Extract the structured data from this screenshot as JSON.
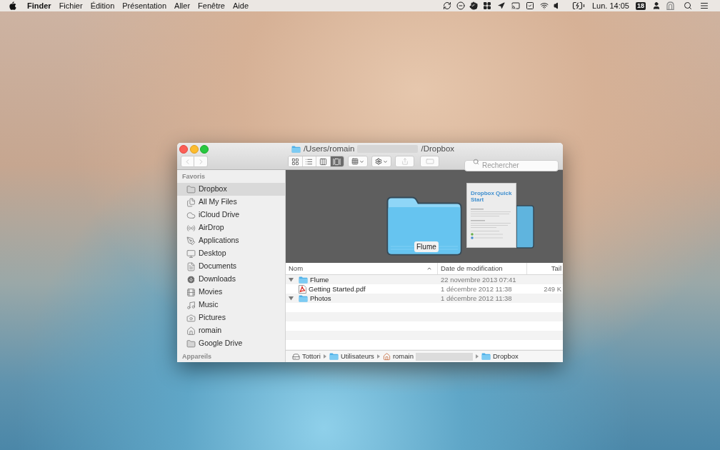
{
  "menubar": {
    "menus": [
      {
        "label": "Finder",
        "kind": "app"
      },
      {
        "label": "Fichier",
        "kind": "menu"
      },
      {
        "label": "Édition",
        "kind": "menu"
      },
      {
        "label": "Présentation",
        "kind": "menu"
      },
      {
        "label": "Aller",
        "kind": "menu"
      },
      {
        "label": "Fenêtre",
        "kind": "menu"
      },
      {
        "label": "Aide",
        "kind": "menu"
      }
    ],
    "clock": "Lun. 14:05",
    "calendar_date": "18"
  },
  "window": {
    "title_start": "/Users/romain",
    "title_redacted": true,
    "title_end": "/Dropbox",
    "toolbar": {
      "back": {
        "disabled": true
      },
      "forward": {
        "disabled": true
      },
      "view_modes": [
        {
          "kind": "icons",
          "selected": false
        },
        {
          "kind": "list",
          "selected": false
        },
        {
          "kind": "columns",
          "selected": false
        },
        {
          "kind": "coverflow",
          "selected": true
        }
      ],
      "share": {
        "disabled": true
      },
      "tags": {
        "disabled": true
      },
      "search": {
        "placeholder": "Rechercher"
      }
    },
    "sidebar": {
      "sections": [
        {
          "heading": "Favoris",
          "items": [
            {
              "label": "Dropbox",
              "kind": "folder",
              "selected": true
            },
            {
              "label": "All My Files",
              "kind": "files",
              "selected": false
            },
            {
              "label": "iCloud Drive",
              "kind": "cloud",
              "selected": false
            },
            {
              "label": "AirDrop",
              "kind": "airdrop",
              "selected": false
            },
            {
              "label": "Applications",
              "kind": "apps",
              "selected": false
            },
            {
              "label": "Desktop",
              "kind": "desktop",
              "selected": false
            },
            {
              "label": "Documents",
              "kind": "documents",
              "selected": false
            },
            {
              "label": "Downloads",
              "kind": "downloads",
              "selected": false
            },
            {
              "label": "Movies",
              "kind": "movies",
              "selected": false
            },
            {
              "label": "Music",
              "kind": "music",
              "selected": false
            },
            {
              "label": "Pictures",
              "kind": "pictures",
              "selected": false
            },
            {
              "label": "romain",
              "kind": "home",
              "selected": false
            },
            {
              "label": "Google Drive",
              "kind": "folder",
              "selected": false
            }
          ]
        },
        {
          "heading": "Appareils"
        }
      ]
    },
    "coverflow": {
      "current_label": "Flume",
      "preview_title": "Dropbox Quick Start"
    },
    "file_list": {
      "columns": [
        "Nom",
        "Date de modification",
        "Tail"
      ],
      "rows": [
        {
          "name": "Flume",
          "kind": "folder",
          "expanded": true,
          "modified": "22 novembre 2013 07:41"
        },
        {
          "name": "Getting Started.pdf",
          "kind": "pdf",
          "modified": "1 décembre 2012 11:38",
          "size": "249 K"
        },
        {
          "name": "Photos",
          "kind": "folder",
          "expanded": true,
          "modified": "1 décembre 2012 11:38"
        }
      ]
    },
    "path_bar": [
      {
        "label": "Tottori",
        "kind": "disk"
      },
      {
        "label": "Utilisateurs",
        "kind": "folder"
      },
      {
        "label": "romain",
        "kind": "home",
        "redacted": true
      },
      {
        "label": "Dropbox",
        "kind": "folder"
      }
    ]
  }
}
